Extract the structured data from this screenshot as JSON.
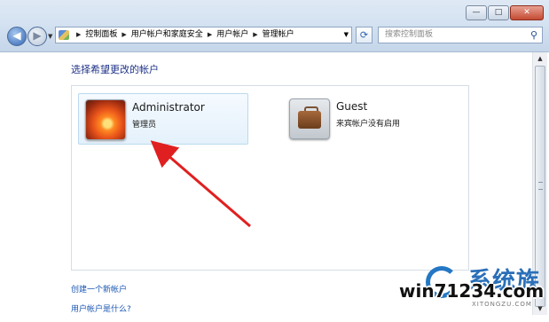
{
  "window": {
    "minimize": "—",
    "maximize": "□",
    "close": "✕"
  },
  "nav": {
    "back_icon": "◀",
    "forward_icon": "▶",
    "breadcrumbs": [
      "控制面板",
      "用户帐户和家庭安全",
      "用户帐户",
      "管理帐户"
    ],
    "search_placeholder": "搜索控制面板"
  },
  "main": {
    "heading": "选择希望更改的帐户",
    "accounts": [
      {
        "name": "Administrator",
        "role": "管理员",
        "icon": "flower-avatar"
      },
      {
        "name": "Guest",
        "role": "来宾帐户没有启用",
        "icon": "briefcase-avatar"
      }
    ],
    "links": [
      "创建一个新帐户",
      "用户帐户是什么?"
    ]
  },
  "annotation": {
    "color": "#e02020"
  },
  "watermark": {
    "site": "win71234.com",
    "brand": "系统族",
    "sub": "XITONGZU.COM"
  }
}
